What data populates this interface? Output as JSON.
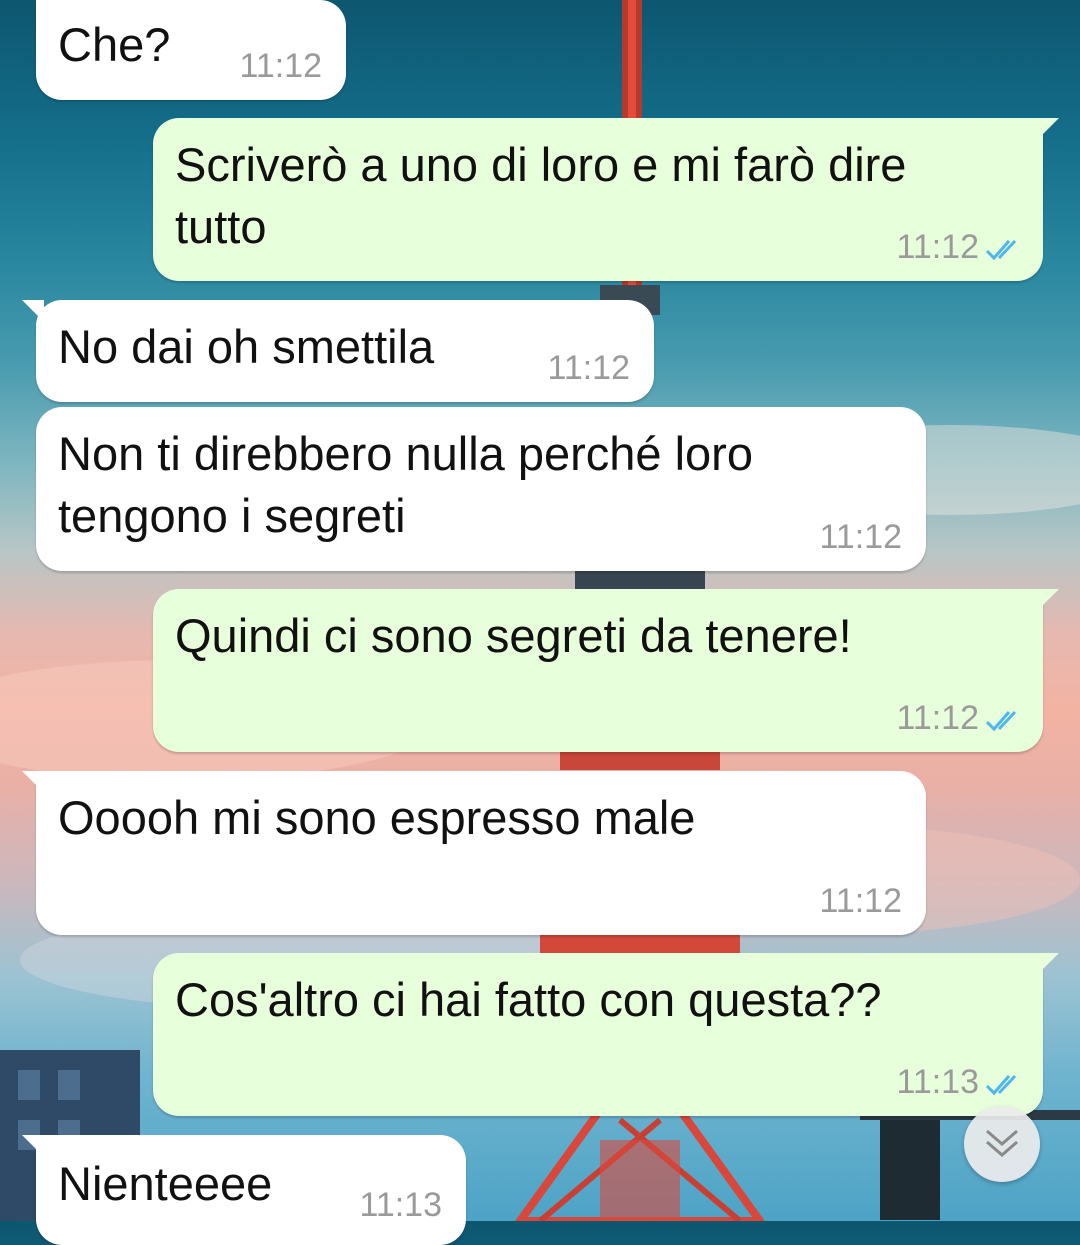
{
  "theme": {
    "incoming_bubble": "#ffffff",
    "outgoing_bubble": "#e7ffdb",
    "timestamp_color": "#9a9a9a",
    "read_ticks_color": "#4fb6ec"
  },
  "messages": [
    {
      "direction": "incoming",
      "text": "Che?",
      "time": "11:12"
    },
    {
      "direction": "outgoing",
      "text": "Scriverò a uno di loro e mi farò dire\ntutto",
      "time": "11:12",
      "status": "read"
    },
    {
      "direction": "incoming",
      "text": "No dai oh smettila",
      "time": "11:12"
    },
    {
      "direction": "incoming",
      "text": "Non ti direbbero nulla perché loro\ntengono i segreti",
      "time": "11:12"
    },
    {
      "direction": "outgoing",
      "text": "Quindi ci sono segreti da tenere!",
      "time": "11:12",
      "status": "read"
    },
    {
      "direction": "incoming",
      "text": "Ooooh mi sono espresso male",
      "time": "11:12"
    },
    {
      "direction": "outgoing",
      "text": "Cos'altro ci hai fatto con questa??",
      "time": "11:13",
      "status": "read"
    },
    {
      "direction": "incoming",
      "text": "Nienteeee",
      "time": "11:13"
    }
  ],
  "controls": {
    "scroll_to_bottom_icon": "double-chevron-down-icon",
    "read_receipt_icon": "double-check-icon"
  }
}
